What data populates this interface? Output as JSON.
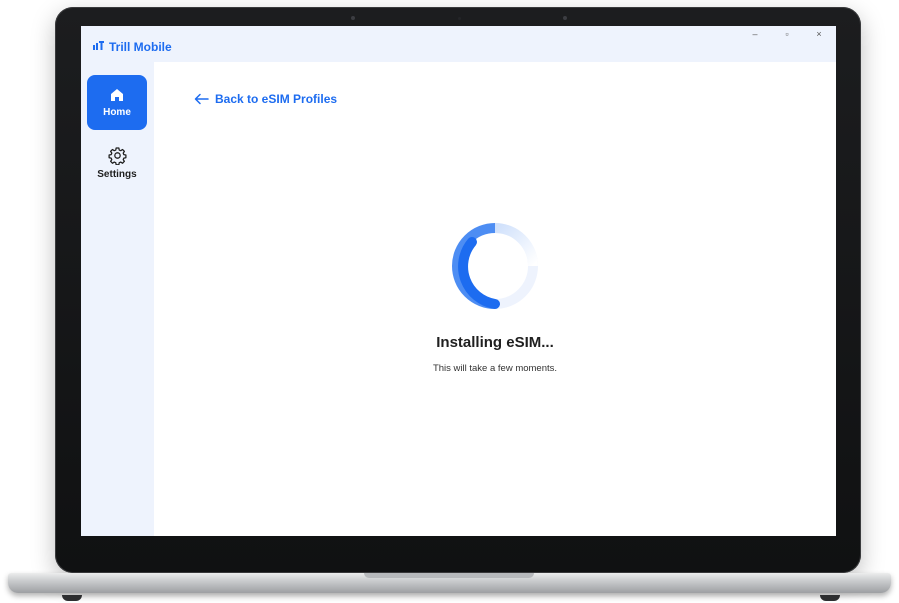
{
  "app": {
    "name": "Trill Mobile",
    "brand_color": "#1d6cf0",
    "brand_icon": "signal-bars-icon"
  },
  "window_controls": {
    "minimize": "–",
    "maximize": "▫",
    "close": "×"
  },
  "sidebar": {
    "items": [
      {
        "label": "Home",
        "icon": "home-icon",
        "active": true
      },
      {
        "label": "Settings",
        "icon": "gear-icon",
        "active": false
      }
    ]
  },
  "main": {
    "back_link": {
      "label": "Back to eSIM Profiles",
      "icon": "arrow-left-icon"
    },
    "status": {
      "title": "Installing eSIM...",
      "subtitle": "This will take a few moments.",
      "spinner_icon": "loading-spinner-icon"
    }
  }
}
